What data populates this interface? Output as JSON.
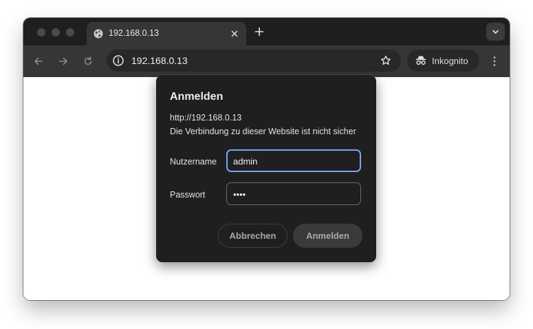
{
  "tab": {
    "title": "192.168.0.13",
    "icon": "globe-icon"
  },
  "toolbar": {
    "url": "192.168.0.13",
    "incognito_label": "Inkognito"
  },
  "dialog": {
    "title": "Anmelden",
    "origin": "http://192.168.0.13",
    "warning": "Die Verbindung zu dieser Website ist nicht sicher",
    "username_label": "Nutzername",
    "username_value": "admin",
    "password_label": "Passwort",
    "password_value": "••••",
    "cancel_label": "Abbrechen",
    "submit_label": "Anmelden"
  },
  "colors": {
    "focus_ring": "#7aa7f5",
    "dialog_bg": "#1f1f1f",
    "tabbar_bg": "#1f1f1f",
    "toolbar_bg": "#363636"
  }
}
